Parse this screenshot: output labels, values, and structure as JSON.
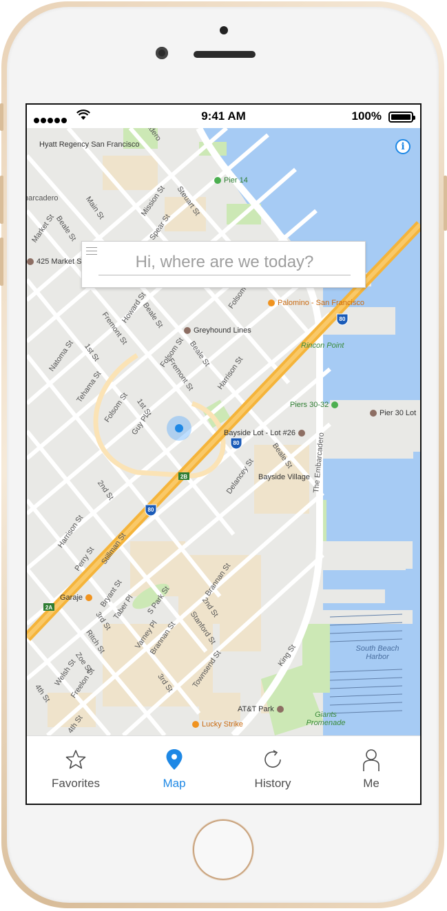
{
  "status_bar": {
    "time": "9:41 AM",
    "battery": "100%"
  },
  "map": {
    "streets": [
      "Main St",
      "Beale St",
      "Market St",
      "Mission St",
      "Spear St",
      "Steuart St",
      "Howard St",
      "Folsom St",
      "Fremont St",
      "1st St",
      "Natoma St",
      "Tehama St",
      "Guy Pl",
      "Harrison St",
      "2nd St",
      "Perry St",
      "Stillman St",
      "Bryant St",
      "Taber Pl",
      "3rd St",
      "Ritch St",
      "Zoe St",
      "Welsh St",
      "Freelon St",
      "4th St",
      "S Park St",
      "Varney Pl",
      "Brannan St",
      "Stanford St",
      "Townsend St",
      "King St",
      "Delancey St",
      "The Embarcadero",
      "adero",
      "barcadero"
    ],
    "places": [
      "Hyatt Regency San Francisco",
      "Pier 14",
      "425 Market St",
      "Palomino - San Francisco",
      "Greyhound Lines",
      "Rincon Point",
      "Piers 30-32",
      "Pier 30 Lot",
      "Bayside Lot - Lot #26",
      "Bayside Village",
      "Garaje",
      "AT&T Park",
      "Giants Promenade",
      "Lucky Strike",
      "South Beach Harbor"
    ],
    "highway_shields": [
      "80",
      "80",
      "80",
      "2B",
      "2A"
    ]
  },
  "search": {
    "placeholder": "Hi, where are we today?"
  },
  "tabs": [
    {
      "label": "Favorites",
      "icon": "star-icon",
      "active": false
    },
    {
      "label": "Map",
      "icon": "map-pin-icon",
      "active": true
    },
    {
      "label": "History",
      "icon": "history-icon",
      "active": false
    },
    {
      "label": "Me",
      "icon": "person-icon",
      "active": false
    }
  ],
  "colors": {
    "accent": "#1e88e5",
    "water": "#a6cbf4",
    "highway": "#f5b43a",
    "park": "#cce8b5",
    "land": "#e9e9e6"
  }
}
